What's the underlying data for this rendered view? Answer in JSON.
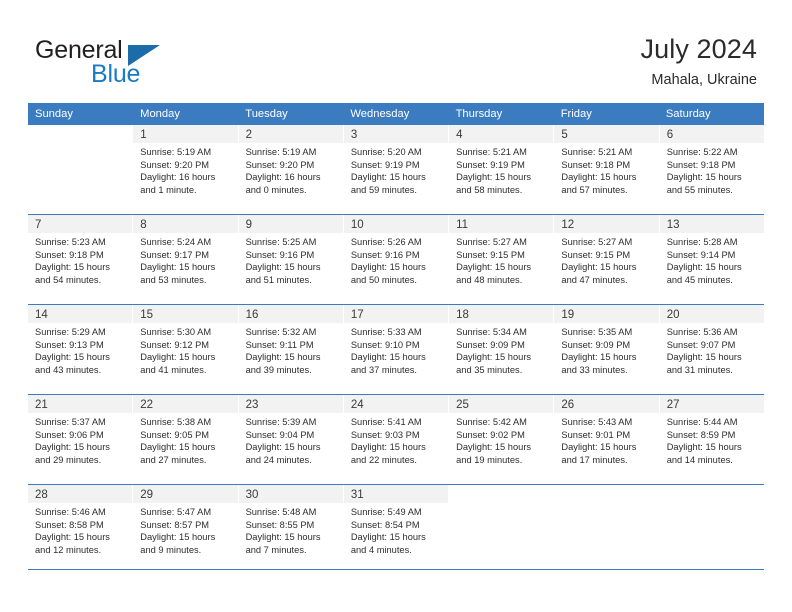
{
  "brand": {
    "name_part1": "General",
    "name_part2": "Blue",
    "triangle_icon": "blue-triangle-icon",
    "accent_color": "#1b7ac4"
  },
  "header": {
    "title": "July 2024",
    "subtitle": "Mahala, Ukraine"
  },
  "theme": {
    "header_row_bg": "#3b7cc0",
    "daynum_bg": "#f2f2f2",
    "grid_line": "#3b7cc0",
    "text": "#2d2d2d"
  },
  "labels": {
    "sunrise": "Sunrise:",
    "sunset": "Sunset:",
    "daylight": "Daylight:"
  },
  "weekdays": [
    "Sunday",
    "Monday",
    "Tuesday",
    "Wednesday",
    "Thursday",
    "Friday",
    "Saturday"
  ],
  "weeks": [
    [
      {
        "day": "",
        "sunrise": "",
        "sunset": "",
        "daylight": ""
      },
      {
        "day": "1",
        "sunrise": "Sunrise: 5:19 AM",
        "sunset": "Sunset: 9:20 PM",
        "daylight": "Daylight: 16 hours and 1 minute."
      },
      {
        "day": "2",
        "sunrise": "Sunrise: 5:19 AM",
        "sunset": "Sunset: 9:20 PM",
        "daylight": "Daylight: 16 hours and 0 minutes."
      },
      {
        "day": "3",
        "sunrise": "Sunrise: 5:20 AM",
        "sunset": "Sunset: 9:19 PM",
        "daylight": "Daylight: 15 hours and 59 minutes."
      },
      {
        "day": "4",
        "sunrise": "Sunrise: 5:21 AM",
        "sunset": "Sunset: 9:19 PM",
        "daylight": "Daylight: 15 hours and 58 minutes."
      },
      {
        "day": "5",
        "sunrise": "Sunrise: 5:21 AM",
        "sunset": "Sunset: 9:18 PM",
        "daylight": "Daylight: 15 hours and 57 minutes."
      },
      {
        "day": "6",
        "sunrise": "Sunrise: 5:22 AM",
        "sunset": "Sunset: 9:18 PM",
        "daylight": "Daylight: 15 hours and 55 minutes."
      }
    ],
    [
      {
        "day": "7",
        "sunrise": "Sunrise: 5:23 AM",
        "sunset": "Sunset: 9:18 PM",
        "daylight": "Daylight: 15 hours and 54 minutes."
      },
      {
        "day": "8",
        "sunrise": "Sunrise: 5:24 AM",
        "sunset": "Sunset: 9:17 PM",
        "daylight": "Daylight: 15 hours and 53 minutes."
      },
      {
        "day": "9",
        "sunrise": "Sunrise: 5:25 AM",
        "sunset": "Sunset: 9:16 PM",
        "daylight": "Daylight: 15 hours and 51 minutes."
      },
      {
        "day": "10",
        "sunrise": "Sunrise: 5:26 AM",
        "sunset": "Sunset: 9:16 PM",
        "daylight": "Daylight: 15 hours and 50 minutes."
      },
      {
        "day": "11",
        "sunrise": "Sunrise: 5:27 AM",
        "sunset": "Sunset: 9:15 PM",
        "daylight": "Daylight: 15 hours and 48 minutes."
      },
      {
        "day": "12",
        "sunrise": "Sunrise: 5:27 AM",
        "sunset": "Sunset: 9:15 PM",
        "daylight": "Daylight: 15 hours and 47 minutes."
      },
      {
        "day": "13",
        "sunrise": "Sunrise: 5:28 AM",
        "sunset": "Sunset: 9:14 PM",
        "daylight": "Daylight: 15 hours and 45 minutes."
      }
    ],
    [
      {
        "day": "14",
        "sunrise": "Sunrise: 5:29 AM",
        "sunset": "Sunset: 9:13 PM",
        "daylight": "Daylight: 15 hours and 43 minutes."
      },
      {
        "day": "15",
        "sunrise": "Sunrise: 5:30 AM",
        "sunset": "Sunset: 9:12 PM",
        "daylight": "Daylight: 15 hours and 41 minutes."
      },
      {
        "day": "16",
        "sunrise": "Sunrise: 5:32 AM",
        "sunset": "Sunset: 9:11 PM",
        "daylight": "Daylight: 15 hours and 39 minutes."
      },
      {
        "day": "17",
        "sunrise": "Sunrise: 5:33 AM",
        "sunset": "Sunset: 9:10 PM",
        "daylight": "Daylight: 15 hours and 37 minutes."
      },
      {
        "day": "18",
        "sunrise": "Sunrise: 5:34 AM",
        "sunset": "Sunset: 9:09 PM",
        "daylight": "Daylight: 15 hours and 35 minutes."
      },
      {
        "day": "19",
        "sunrise": "Sunrise: 5:35 AM",
        "sunset": "Sunset: 9:09 PM",
        "daylight": "Daylight: 15 hours and 33 minutes."
      },
      {
        "day": "20",
        "sunrise": "Sunrise: 5:36 AM",
        "sunset": "Sunset: 9:07 PM",
        "daylight": "Daylight: 15 hours and 31 minutes."
      }
    ],
    [
      {
        "day": "21",
        "sunrise": "Sunrise: 5:37 AM",
        "sunset": "Sunset: 9:06 PM",
        "daylight": "Daylight: 15 hours and 29 minutes."
      },
      {
        "day": "22",
        "sunrise": "Sunrise: 5:38 AM",
        "sunset": "Sunset: 9:05 PM",
        "daylight": "Daylight: 15 hours and 27 minutes."
      },
      {
        "day": "23",
        "sunrise": "Sunrise: 5:39 AM",
        "sunset": "Sunset: 9:04 PM",
        "daylight": "Daylight: 15 hours and 24 minutes."
      },
      {
        "day": "24",
        "sunrise": "Sunrise: 5:41 AM",
        "sunset": "Sunset: 9:03 PM",
        "daylight": "Daylight: 15 hours and 22 minutes."
      },
      {
        "day": "25",
        "sunrise": "Sunrise: 5:42 AM",
        "sunset": "Sunset: 9:02 PM",
        "daylight": "Daylight: 15 hours and 19 minutes."
      },
      {
        "day": "26",
        "sunrise": "Sunrise: 5:43 AM",
        "sunset": "Sunset: 9:01 PM",
        "daylight": "Daylight: 15 hours and 17 minutes."
      },
      {
        "day": "27",
        "sunrise": "Sunrise: 5:44 AM",
        "sunset": "Sunset: 8:59 PM",
        "daylight": "Daylight: 15 hours and 14 minutes."
      }
    ],
    [
      {
        "day": "28",
        "sunrise": "Sunrise: 5:46 AM",
        "sunset": "Sunset: 8:58 PM",
        "daylight": "Daylight: 15 hours and 12 minutes."
      },
      {
        "day": "29",
        "sunrise": "Sunrise: 5:47 AM",
        "sunset": "Sunset: 8:57 PM",
        "daylight": "Daylight: 15 hours and 9 minutes."
      },
      {
        "day": "30",
        "sunrise": "Sunrise: 5:48 AM",
        "sunset": "Sunset: 8:55 PM",
        "daylight": "Daylight: 15 hours and 7 minutes."
      },
      {
        "day": "31",
        "sunrise": "Sunrise: 5:49 AM",
        "sunset": "Sunset: 8:54 PM",
        "daylight": "Daylight: 15 hours and 4 minutes."
      },
      {
        "day": "",
        "sunrise": "",
        "sunset": "",
        "daylight": ""
      },
      {
        "day": "",
        "sunrise": "",
        "sunset": "",
        "daylight": ""
      },
      {
        "day": "",
        "sunrise": "",
        "sunset": "",
        "daylight": ""
      }
    ]
  ]
}
